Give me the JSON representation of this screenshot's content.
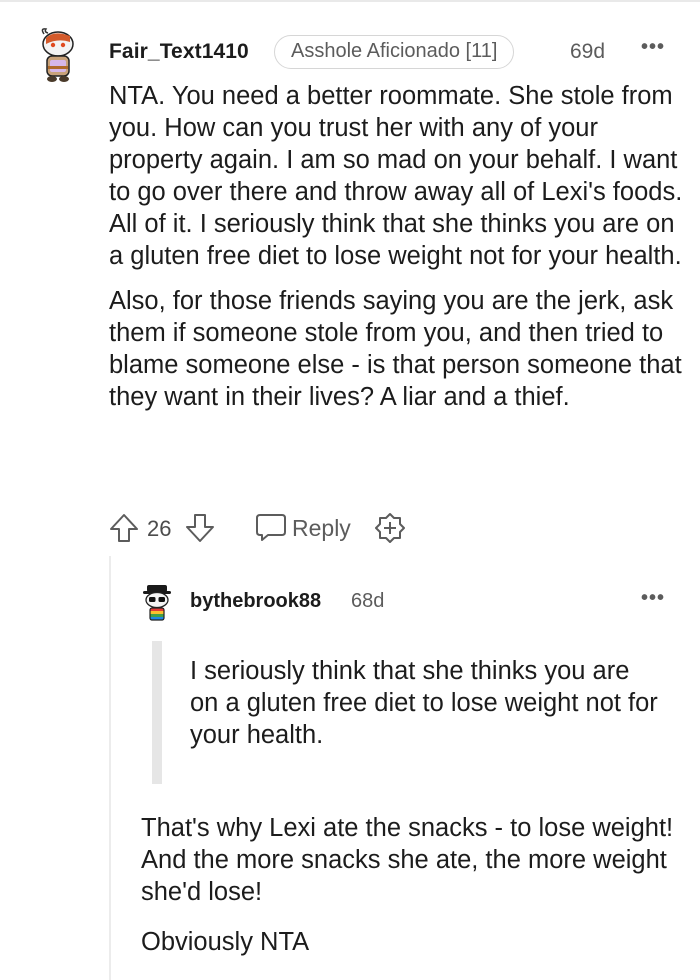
{
  "comment": {
    "username": "Fair_Text1410",
    "flair": "Asshole Aficionado [11]",
    "age": "69d",
    "more_label": "•••",
    "paragraphs": [
      "NTA. You need a better roommate. She stole from you. How can you trust her with any of your property again. I am so mad on your behalf. I want to go over there and throw away all of Lexi's foods. All of it. I seriously think that she thinks you are on a gluten free diet to lose weight not for your health.",
      "Also, for those friends saying you are the jerk, ask them if someone stole from you, and then tried to blame someone else - is that person someone that they want in their lives? A liar and a thief."
    ],
    "score": "26",
    "reply_label": "Reply",
    "icons": {
      "upvote": "upvote-arrow-icon",
      "downvote": "downvote-arrow-icon",
      "reply": "speech-bubble-icon",
      "award": "award-plus-icon",
      "more": "more-dots-icon"
    }
  },
  "reply": {
    "username": "bythebrook88",
    "age": "68d",
    "more_label": "•••",
    "quote": "I seriously think that she thinks you are on a gluten free diet to lose weight not for your health.",
    "paragraphs": [
      "That's why Lexi ate the snacks - to lose weight! And the more snacks she ate, the more weight she'd lose!",
      "Obviously NTA"
    ]
  },
  "colors": {
    "text": "#1c1c1c",
    "meta": "#5c5c5c",
    "flair_border": "#d6d6d6",
    "quote_bar": "#e6e6e6"
  }
}
